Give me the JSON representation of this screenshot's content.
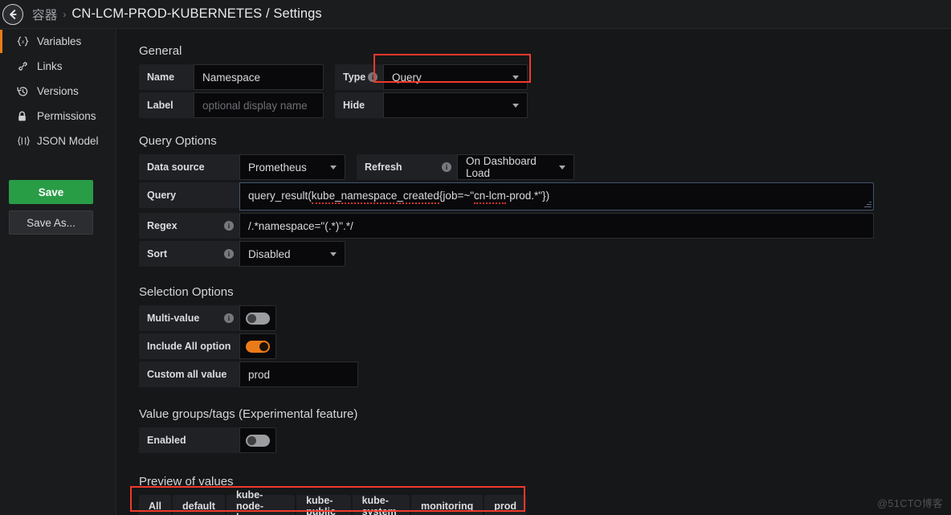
{
  "header": {
    "back_icon": "arrow-left-icon",
    "breadcrumb_parent": "容器",
    "breadcrumb_separator": "›",
    "breadcrumb_current": "CN-LCM-PROD-KUBERNETES / Settings"
  },
  "sidebar": {
    "items": [
      {
        "label": "Variables",
        "icon": "variables-icon",
        "active": true
      },
      {
        "label": "Links",
        "icon": "link-icon",
        "active": false
      },
      {
        "label": "Versions",
        "icon": "history-icon",
        "active": false
      },
      {
        "label": "Permissions",
        "icon": "lock-icon",
        "active": false
      },
      {
        "label": "JSON Model",
        "icon": "json-braces-icon",
        "active": false
      }
    ],
    "save_label": "Save",
    "save_as_label": "Save As..."
  },
  "general": {
    "title": "General",
    "name_label": "Name",
    "name_value": "Namespace",
    "label_label": "Label",
    "label_placeholder": "optional display name",
    "type_label": "Type",
    "type_value": "Query",
    "hide_label": "Hide",
    "hide_value": ""
  },
  "query_options": {
    "title": "Query Options",
    "datasource_label": "Data source",
    "datasource_value": "Prometheus",
    "refresh_label": "Refresh",
    "refresh_value": "On Dashboard Load",
    "query_label": "Query",
    "query_value": "query_result(kube_namespace_created{job=~\"cn-lcm-prod.*\"})",
    "query_parts": {
      "p1": "query_result(",
      "p2": "kube_namespace_created",
      "p3": "{job=~\"",
      "p4": "cn-lcm",
      "p5": "-prod.*\"})"
    },
    "regex_label": "Regex",
    "regex_value": "/.*namespace=\"(.*)\".*/",
    "sort_label": "Sort",
    "sort_value": "Disabled"
  },
  "selection_options": {
    "title": "Selection Options",
    "multi_value_label": "Multi-value",
    "multi_value_on": false,
    "include_all_label": "Include All option",
    "include_all_on": true,
    "custom_all_label": "Custom all value",
    "custom_all_value": "prod"
  },
  "value_groups": {
    "title": "Value groups/tags (Experimental feature)",
    "enabled_label": "Enabled",
    "enabled_on": false
  },
  "preview": {
    "title": "Preview of values",
    "values": [
      "All",
      "default",
      "kube-node-lease",
      "kube-public",
      "kube-system",
      "monitoring",
      "prod"
    ]
  },
  "watermark": "@51CTO博客",
  "colors": {
    "accent_orange": "#eb7b18",
    "save_green": "#299c46",
    "annotation_red": "#f0392b",
    "focus_blue": "#41566e",
    "panel_bg": "#161719",
    "field_label_bg": "#202124",
    "input_bg": "#09090b"
  }
}
